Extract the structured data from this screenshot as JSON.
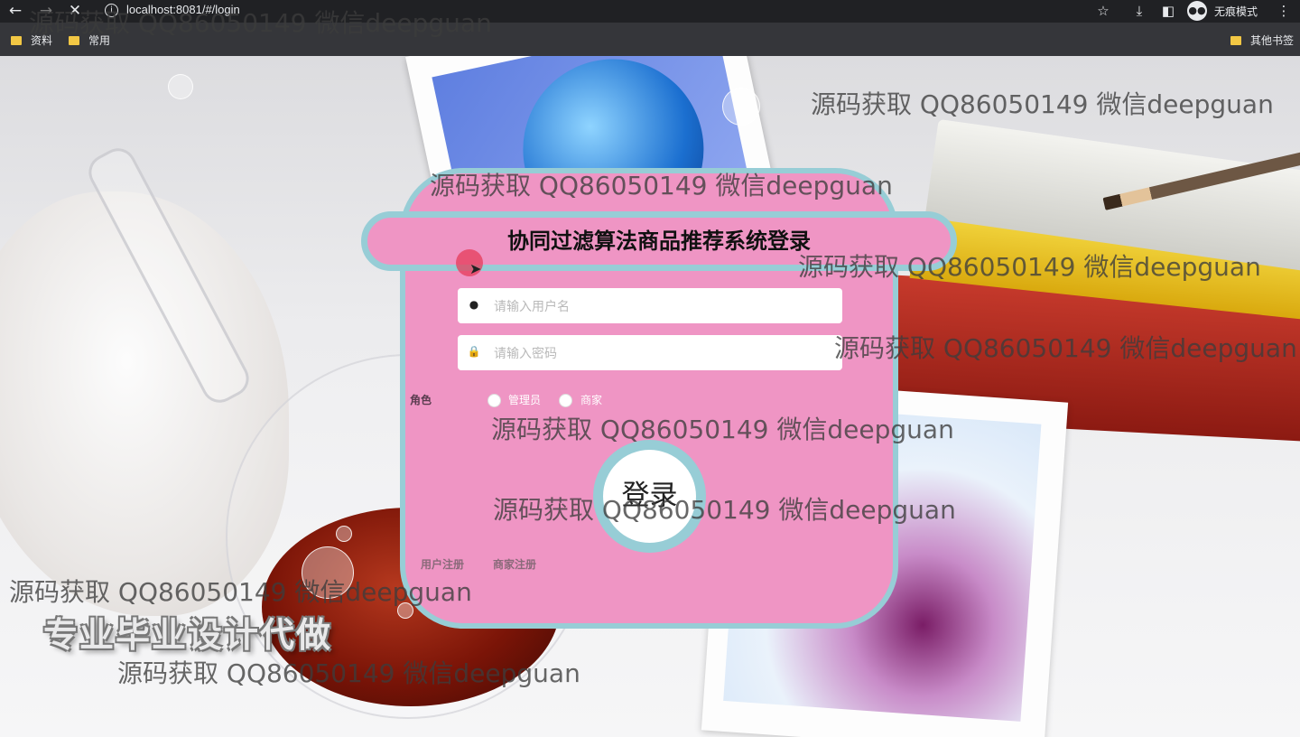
{
  "browser": {
    "url": "localhost:8081/#/login",
    "incognito_label": "无痕模式",
    "bookmarks": [
      "资料",
      "常用"
    ],
    "other_bookmarks": "其他书签"
  },
  "login": {
    "title": "协同过滤算法商品推荐系统登录",
    "username_placeholder": "请输入用户名",
    "password_placeholder": "请输入密码",
    "role_label": "角色",
    "roles": [
      "管理员",
      "商家"
    ],
    "login_button": "登录",
    "register_links": [
      "用户注册",
      "商家注册"
    ]
  },
  "background": {
    "slogan": "专业毕业设计代做"
  },
  "watermark": "源码获取 QQ86050149 微信deepguan",
  "colors": {
    "card": "#ef95c4",
    "border": "#97cdd6"
  }
}
